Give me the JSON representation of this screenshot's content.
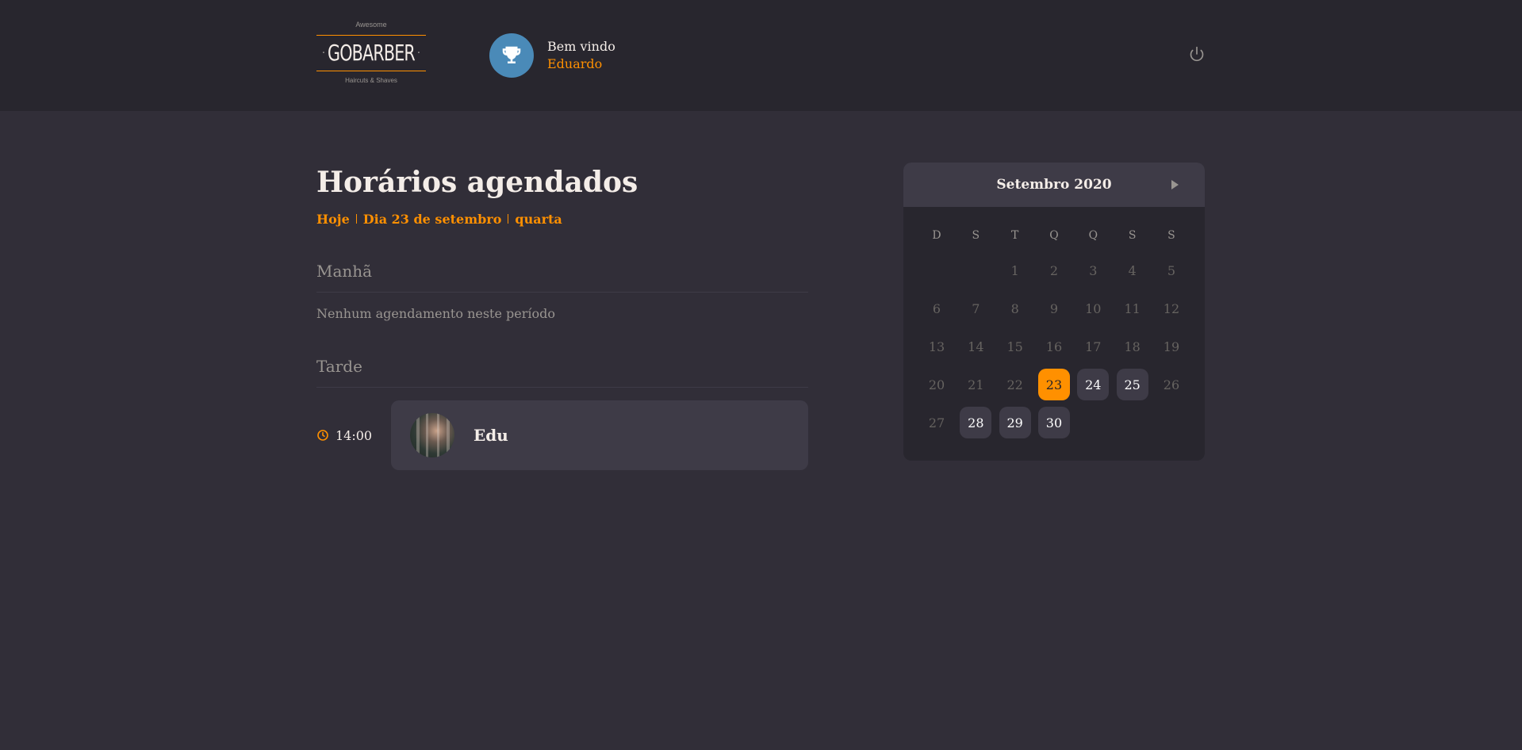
{
  "header": {
    "logo": {
      "top_text": "Awesome",
      "brand": "GOBARBER",
      "bottom_text": "Haircuts & Shaves"
    },
    "profile": {
      "welcome": "Bem vindo",
      "name": "Eduardo",
      "avatar_icon": "trophy-icon"
    },
    "logout_icon": "power-icon"
  },
  "schedule": {
    "title": "Horários agendados",
    "date_parts": [
      "Hoje",
      "Dia 23 de setembro",
      "quarta"
    ],
    "morning": {
      "title": "Manhã",
      "empty": "Nenhum agendamento neste período"
    },
    "afternoon": {
      "title": "Tarde",
      "appointments": [
        {
          "time": "14:00",
          "name": "Edu"
        }
      ]
    }
  },
  "calendar": {
    "month_label": "Setembro 2020",
    "weekdays": [
      "D",
      "S",
      "T",
      "Q",
      "Q",
      "S",
      "S"
    ],
    "weeks": [
      [
        "",
        "",
        "1",
        "2",
        "3",
        "4",
        "5"
      ],
      [
        "6",
        "7",
        "8",
        "9",
        "10",
        "11",
        "12"
      ],
      [
        "13",
        "14",
        "15",
        "16",
        "17",
        "18",
        "19"
      ],
      [
        "20",
        "21",
        "22",
        "23",
        "24",
        "25",
        "26"
      ],
      [
        "27",
        "28",
        "29",
        "30",
        "",
        "",
        ""
      ]
    ],
    "selected_day": "23",
    "available_days": [
      "24",
      "25",
      "28",
      "29",
      "30"
    ]
  },
  "colors": {
    "accent": "#ff9000",
    "background": "#312e38",
    "header": "#28262e",
    "card": "#3e3b47"
  }
}
